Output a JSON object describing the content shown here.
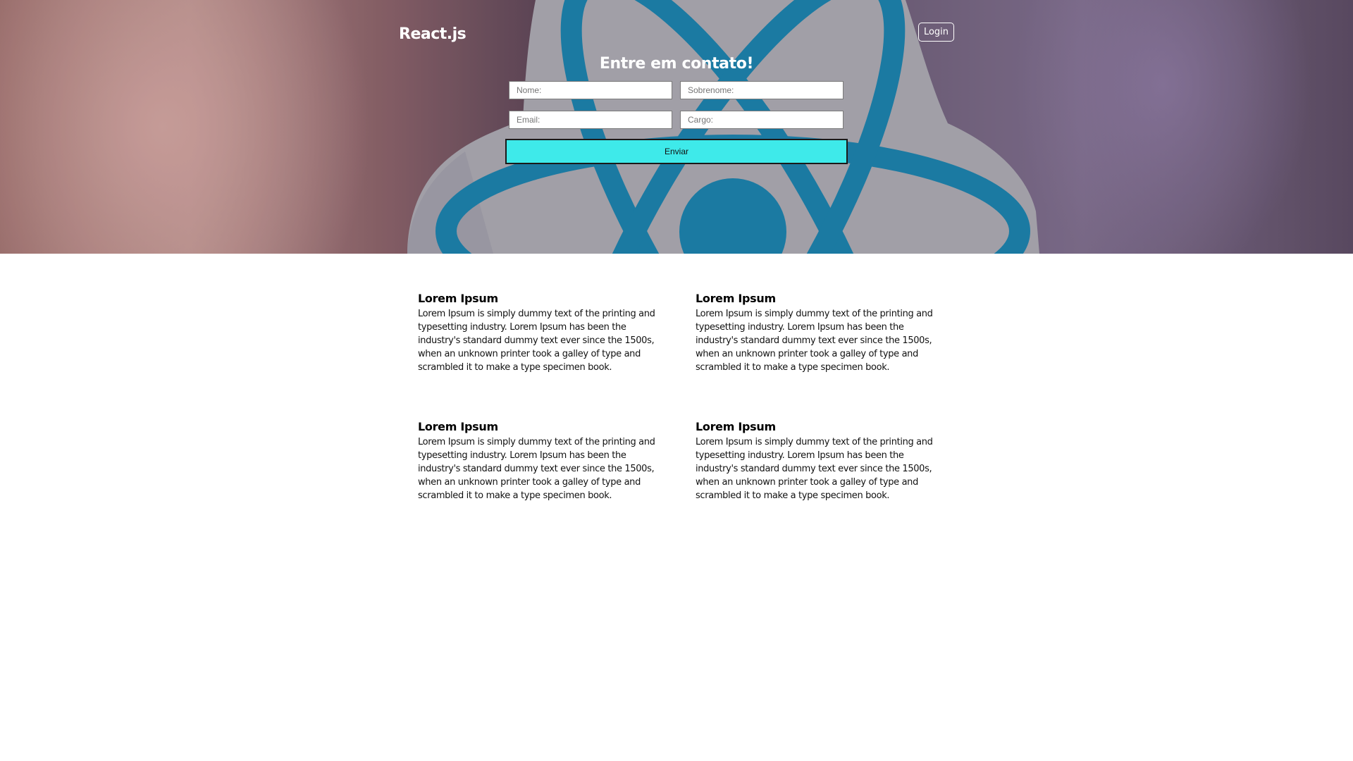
{
  "header": {
    "logo": "React.js",
    "login_label": "Login"
  },
  "contact_form": {
    "title": "Entre em contato!",
    "fields": {
      "first_name_placeholder": "Nome:",
      "last_name_placeholder": "Sobrenome:",
      "email_placeholder": "Email:",
      "role_placeholder": "Cargo:"
    },
    "submit_label": "Enviar"
  },
  "cards": [
    {
      "title": "Lorem Ipsum",
      "text": "Lorem Ipsum is simply dummy text of the printing and typesetting industry. Lorem Ipsum has been the industry's standard dummy text ever since the 1500s, when an unknown printer took a galley of type and scrambled it to make a type specimen book."
    },
    {
      "title": "Lorem Ipsum",
      "text": "Lorem Ipsum is simply dummy text of the printing and typesetting industry. Lorem Ipsum has been the industry's standard dummy text ever since the 1500s, when an unknown printer took a galley of type and scrambled it to make a type specimen book."
    },
    {
      "title": "Lorem Ipsum",
      "text": "Lorem Ipsum is simply dummy text of the printing and typesetting industry. Lorem Ipsum has been the industry's standard dummy text ever since the 1500s, when an unknown printer took a galley of type and scrambled it to make a type specimen book."
    },
    {
      "title": "Lorem Ipsum",
      "text": "Lorem Ipsum is simply dummy text of the printing and typesetting industry. Lorem Ipsum has been the industry's standard dummy text ever since the 1500s, when an unknown printer took a galley of type and scrambled it to make a type specimen book."
    }
  ],
  "colors": {
    "submit_button": "#3eeaea",
    "react_logo": "#1a7fa8",
    "sticker": "#a7a5ad"
  },
  "icons": {
    "hero_background": "react-atom-sticker-icon"
  }
}
